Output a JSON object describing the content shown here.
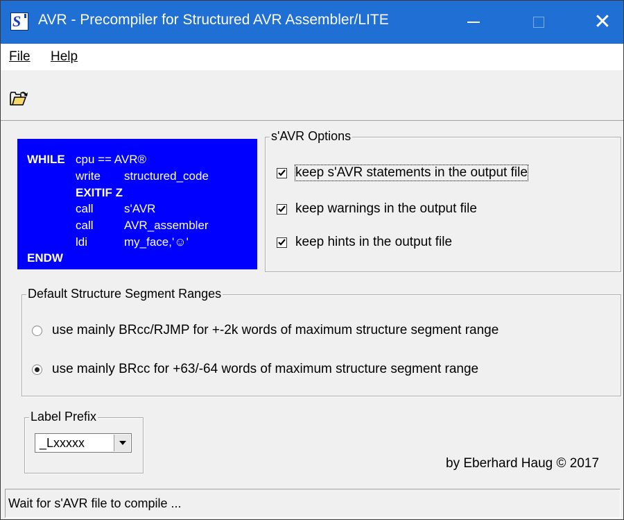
{
  "window": {
    "title": "AVR - Precompiler for Structured AVR Assembler/LITE",
    "app_icon_glyph": "S",
    "close_glyph": "✕"
  },
  "menu": {
    "file": "File",
    "help": "Help"
  },
  "toolbar": {
    "open_icon": "open-folder-icon"
  },
  "promo": {
    "background": "#0000ff",
    "lines": [
      {
        "keyword": "WHILE",
        "text": "cpu == AVR®"
      },
      {
        "arg1": "write",
        "arg2": "structured_code"
      },
      {
        "keyword": "EXITIF Z"
      },
      {
        "arg1": "call",
        "arg2": "s'AVR"
      },
      {
        "arg1": "call",
        "arg2": "AVR_assembler"
      },
      {
        "arg1": "ldi",
        "arg2": "my_face,'☺'"
      },
      {
        "keyword": "ENDW"
      }
    ]
  },
  "options": {
    "title": "s'AVR Options",
    "items": [
      {
        "label": "keep s'AVR statements in the output file",
        "checked": true
      },
      {
        "label": "keep warnings in the output file",
        "checked": true
      },
      {
        "label": "keep hints in the output file",
        "checked": true
      }
    ]
  },
  "ranges": {
    "title": "Default Structure Segment Ranges",
    "items": [
      {
        "label": "use mainly BRcc/RJMP for  +-2k words of maximum structure segment range",
        "selected": false
      },
      {
        "label": "use mainly BRcc for +63/-64 words of maximum structure segment range",
        "selected": true
      }
    ]
  },
  "prefix": {
    "title": "Label Prefix",
    "value": "_Lxxxxx"
  },
  "credit": "by Eberhard Haug © 2017",
  "status": "Wait for s'AVR file to compile ...",
  "colors": {
    "titlebar": "#1f6fd5",
    "promo": "#0000ff"
  }
}
